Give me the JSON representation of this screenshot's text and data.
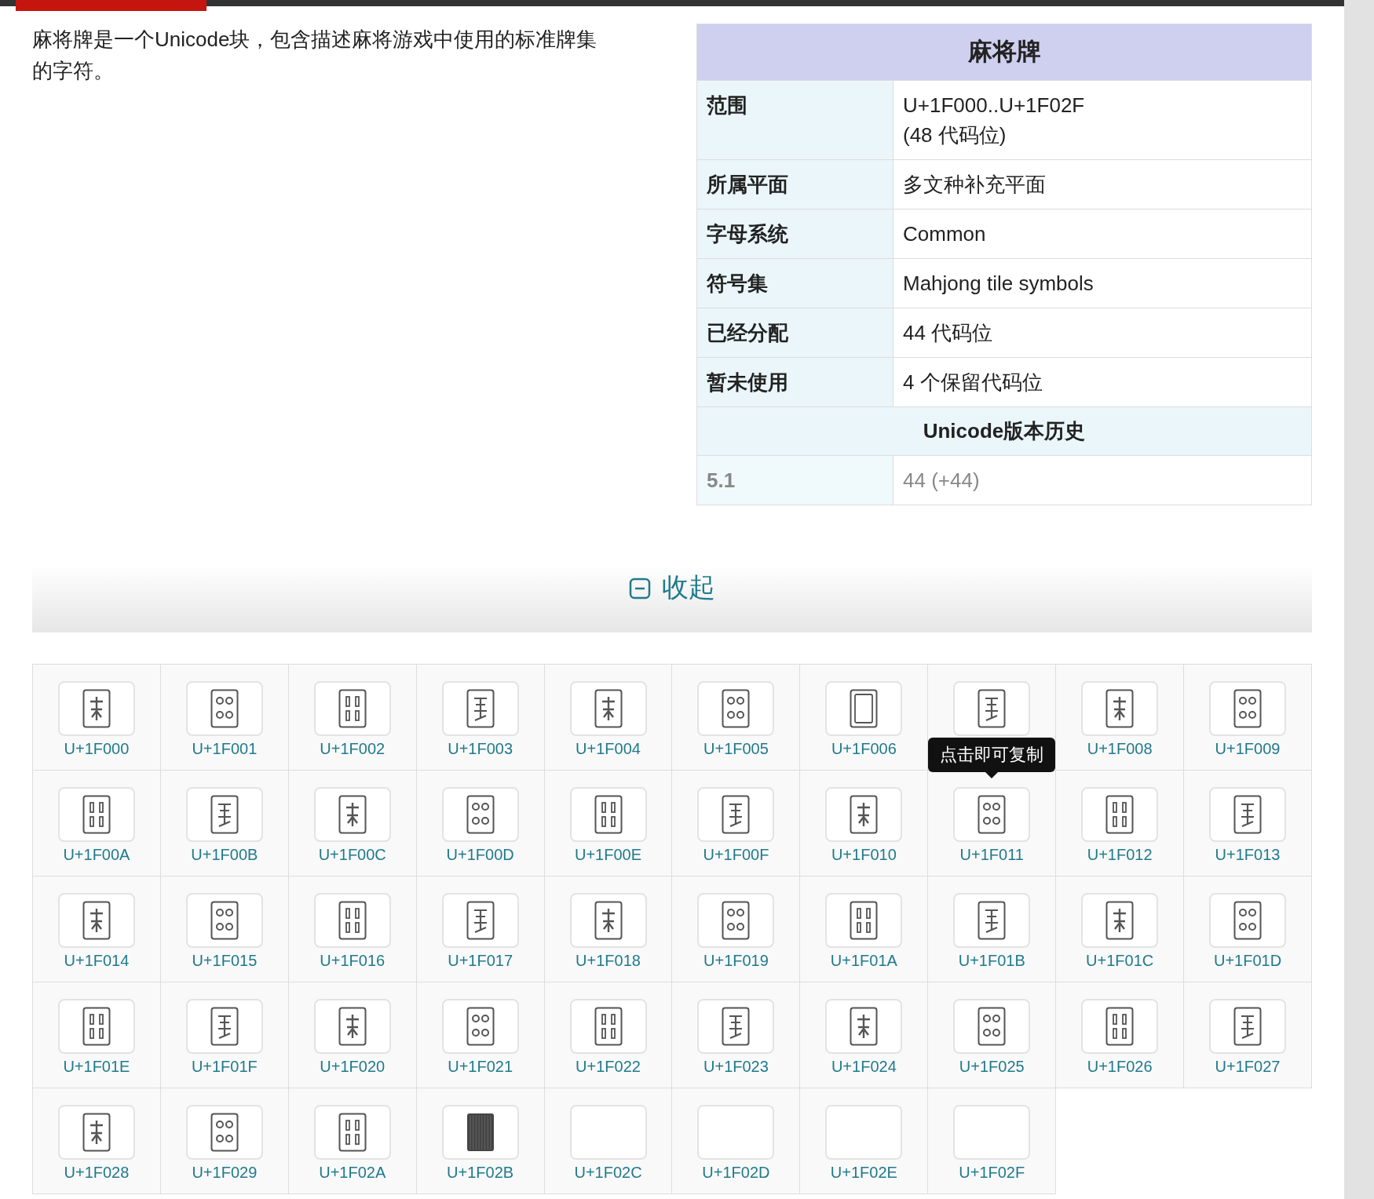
{
  "intro": "麻将牌是一个Unicode块，包含描述麻将游戏中使用的标准牌集的字符。",
  "infobox": {
    "title": "麻将牌",
    "rows": [
      {
        "label": "范围",
        "value": "U+1F000..U+1F02F\n(48 代码位)"
      },
      {
        "label": "所属平面",
        "value": "多文种补充平面"
      },
      {
        "label": "字母系统",
        "value": "Common"
      },
      {
        "label": "符号集",
        "value": "Mahjong tile symbols"
      },
      {
        "label": "已经分配",
        "value": "44 代码位"
      },
      {
        "label": "暂未使用",
        "value": "4 个保留代码位"
      }
    ],
    "history_title": "Unicode版本历史",
    "history": [
      {
        "version": "5.1",
        "count": "44 (+44)"
      }
    ]
  },
  "collapse": {
    "label": "收起"
  },
  "tiles": [
    {
      "kind": "tile",
      "code": "U+1F000"
    },
    {
      "kind": "tile",
      "code": "U+1F001"
    },
    {
      "kind": "tile",
      "code": "U+1F002"
    },
    {
      "kind": "tile",
      "code": "U+1F003"
    },
    {
      "kind": "tile",
      "code": "U+1F004"
    },
    {
      "kind": "tile",
      "code": "U+1F005"
    },
    {
      "kind": "frame",
      "code": "U+1F006"
    },
    {
      "kind": "tile",
      "tooltip": "点击即可复制"
    },
    {
      "kind": "tile",
      "code": "U+1F008"
    },
    {
      "kind": "tile",
      "code": "U+1F009"
    },
    {
      "kind": "tile",
      "code": "U+1F00A"
    },
    {
      "kind": "tile",
      "code": "U+1F00B"
    },
    {
      "kind": "tile",
      "code": "U+1F00C"
    },
    {
      "kind": "tile",
      "code": "U+1F00D"
    },
    {
      "kind": "tile",
      "code": "U+1F00E"
    },
    {
      "kind": "tile",
      "code": "U+1F00F"
    },
    {
      "kind": "tile",
      "code": "U+1F010"
    },
    {
      "kind": "tile",
      "code": "U+1F011"
    },
    {
      "kind": "tile",
      "code": "U+1F012"
    },
    {
      "kind": "tile",
      "code": "U+1F013"
    },
    {
      "kind": "tile",
      "code": "U+1F014"
    },
    {
      "kind": "tile",
      "code": "U+1F015"
    },
    {
      "kind": "tile",
      "code": "U+1F016"
    },
    {
      "kind": "tile",
      "code": "U+1F017"
    },
    {
      "kind": "tile",
      "code": "U+1F018"
    },
    {
      "kind": "tile",
      "code": "U+1F019"
    },
    {
      "kind": "tile",
      "code": "U+1F01A"
    },
    {
      "kind": "tile",
      "code": "U+1F01B"
    },
    {
      "kind": "tile",
      "code": "U+1F01C"
    },
    {
      "kind": "tile",
      "code": "U+1F01D"
    },
    {
      "kind": "tile",
      "code": "U+1F01E"
    },
    {
      "kind": "tile",
      "code": "U+1F01F"
    },
    {
      "kind": "tile",
      "code": "U+1F020"
    },
    {
      "kind": "tile",
      "code": "U+1F021"
    },
    {
      "kind": "tile",
      "code": "U+1F022"
    },
    {
      "kind": "tile",
      "code": "U+1F023"
    },
    {
      "kind": "tile",
      "code": "U+1F024"
    },
    {
      "kind": "tile",
      "code": "U+1F025"
    },
    {
      "kind": "tile",
      "code": "U+1F026"
    },
    {
      "kind": "tile",
      "code": "U+1F027"
    },
    {
      "kind": "tile",
      "code": "U+1F028"
    },
    {
      "kind": "tile",
      "code": "U+1F029"
    },
    {
      "kind": "tile",
      "code": "U+1F02A"
    },
    {
      "kind": "back",
      "code": "U+1F02B"
    },
    {
      "kind": "empty",
      "code": "U+1F02C"
    },
    {
      "kind": "empty",
      "code": "U+1F02D"
    },
    {
      "kind": "empty",
      "code": "U+1F02E"
    },
    {
      "kind": "empty",
      "code": "U+1F02F"
    }
  ]
}
